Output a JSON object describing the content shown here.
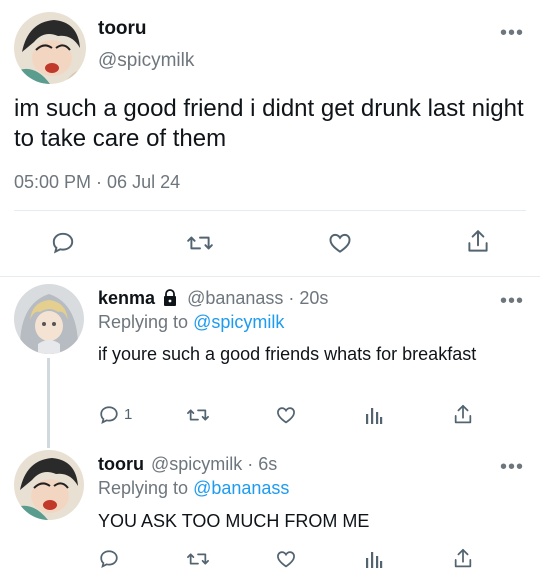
{
  "main_tweet": {
    "display_name": "tooru",
    "handle": "@spicymilk",
    "text": "im such a good friend i didnt get drunk last night to take care of them",
    "timestamp": "05:00 PM · 06 Jul 24",
    "actions": [
      "reply-icon",
      "retweet-icon",
      "like-icon",
      "share-icon"
    ]
  },
  "replies": [
    {
      "display_name": "kenma",
      "locked_icon": "lock-icon",
      "handle_meta": "@bananass · 20s",
      "replying_to_label": "Replying to ",
      "replying_to_handle": "@spicymilk",
      "text": "if youre such a good friends whats for breakfast",
      "reply_count": "1",
      "actions": [
        "reply-icon",
        "retweet-icon",
        "like-icon",
        "analytics-icon",
        "share-icon"
      ]
    },
    {
      "display_name": "tooru",
      "handle_meta": "@spicymilk · 6s",
      "replying_to_label": "Replying to ",
      "replying_to_handle": "@bananass",
      "text": "YOU ASK TOO MUCH FROM ME",
      "actions": [
        "reply-icon",
        "retweet-icon",
        "like-icon",
        "analytics-icon",
        "share-icon"
      ]
    }
  ],
  "colors": {
    "text": "#0f1419",
    "muted": "#6e767d",
    "link": "#1d9bf0",
    "divider": "#e6ecf0"
  }
}
